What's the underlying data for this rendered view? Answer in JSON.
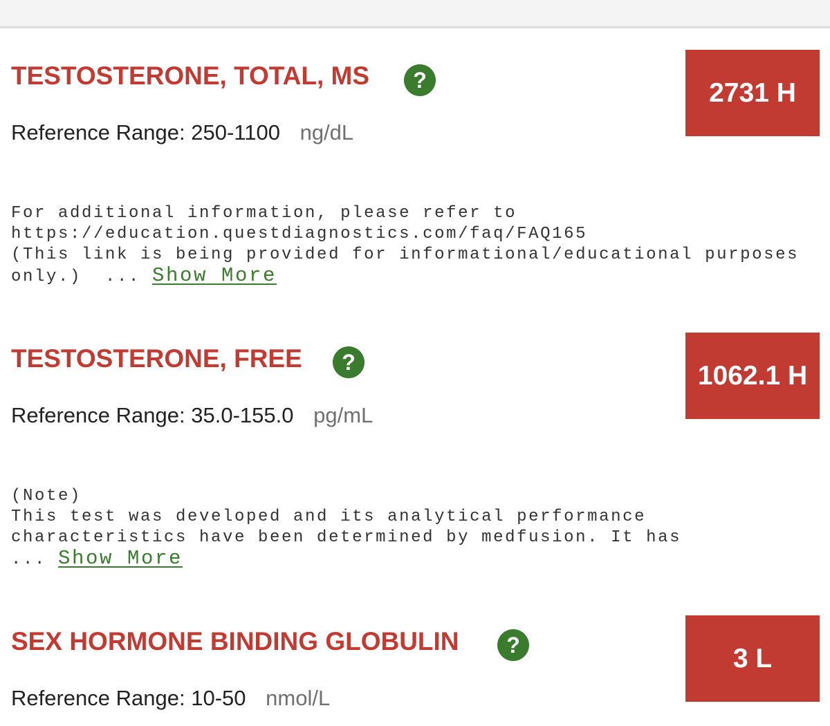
{
  "results": [
    {
      "name": "TESTOSTERONE, TOTAL, MS",
      "help_icon": "question-circle-icon",
      "ref_label": "Reference Range:",
      "ref_range": "250-1100",
      "unit": "ng/dL",
      "value": "2731 H",
      "note_lines": [
        "For additional information, please refer to",
        "https://education.questdiagnostics.com/faq/FAQ165",
        "(This link is being provided for informational/educational purposes"
      ],
      "note_last": "only.)  ... ",
      "show_more": "Show More"
    },
    {
      "name": "TESTOSTERONE, FREE",
      "help_icon": "question-circle-icon",
      "ref_label": "Reference Range:",
      "ref_range": "35.0-155.0",
      "unit": "pg/mL",
      "value": "1062.1 H",
      "note_lines": [
        "(Note)",
        "This test was developed and its analytical performance",
        "characteristics have been determined by medfusion. It has"
      ],
      "note_last": "... ",
      "show_more": "Show More"
    },
    {
      "name": "SEX HORMONE BINDING GLOBULIN",
      "help_icon": "question-circle-icon",
      "ref_label": "Reference Range:",
      "ref_range": "10-50",
      "unit": "nmol/L",
      "value": "3 L"
    }
  ],
  "colors": {
    "flag_red": "#c23b33",
    "help_green": "#3a7b2e",
    "unit_gray": "#707070"
  }
}
